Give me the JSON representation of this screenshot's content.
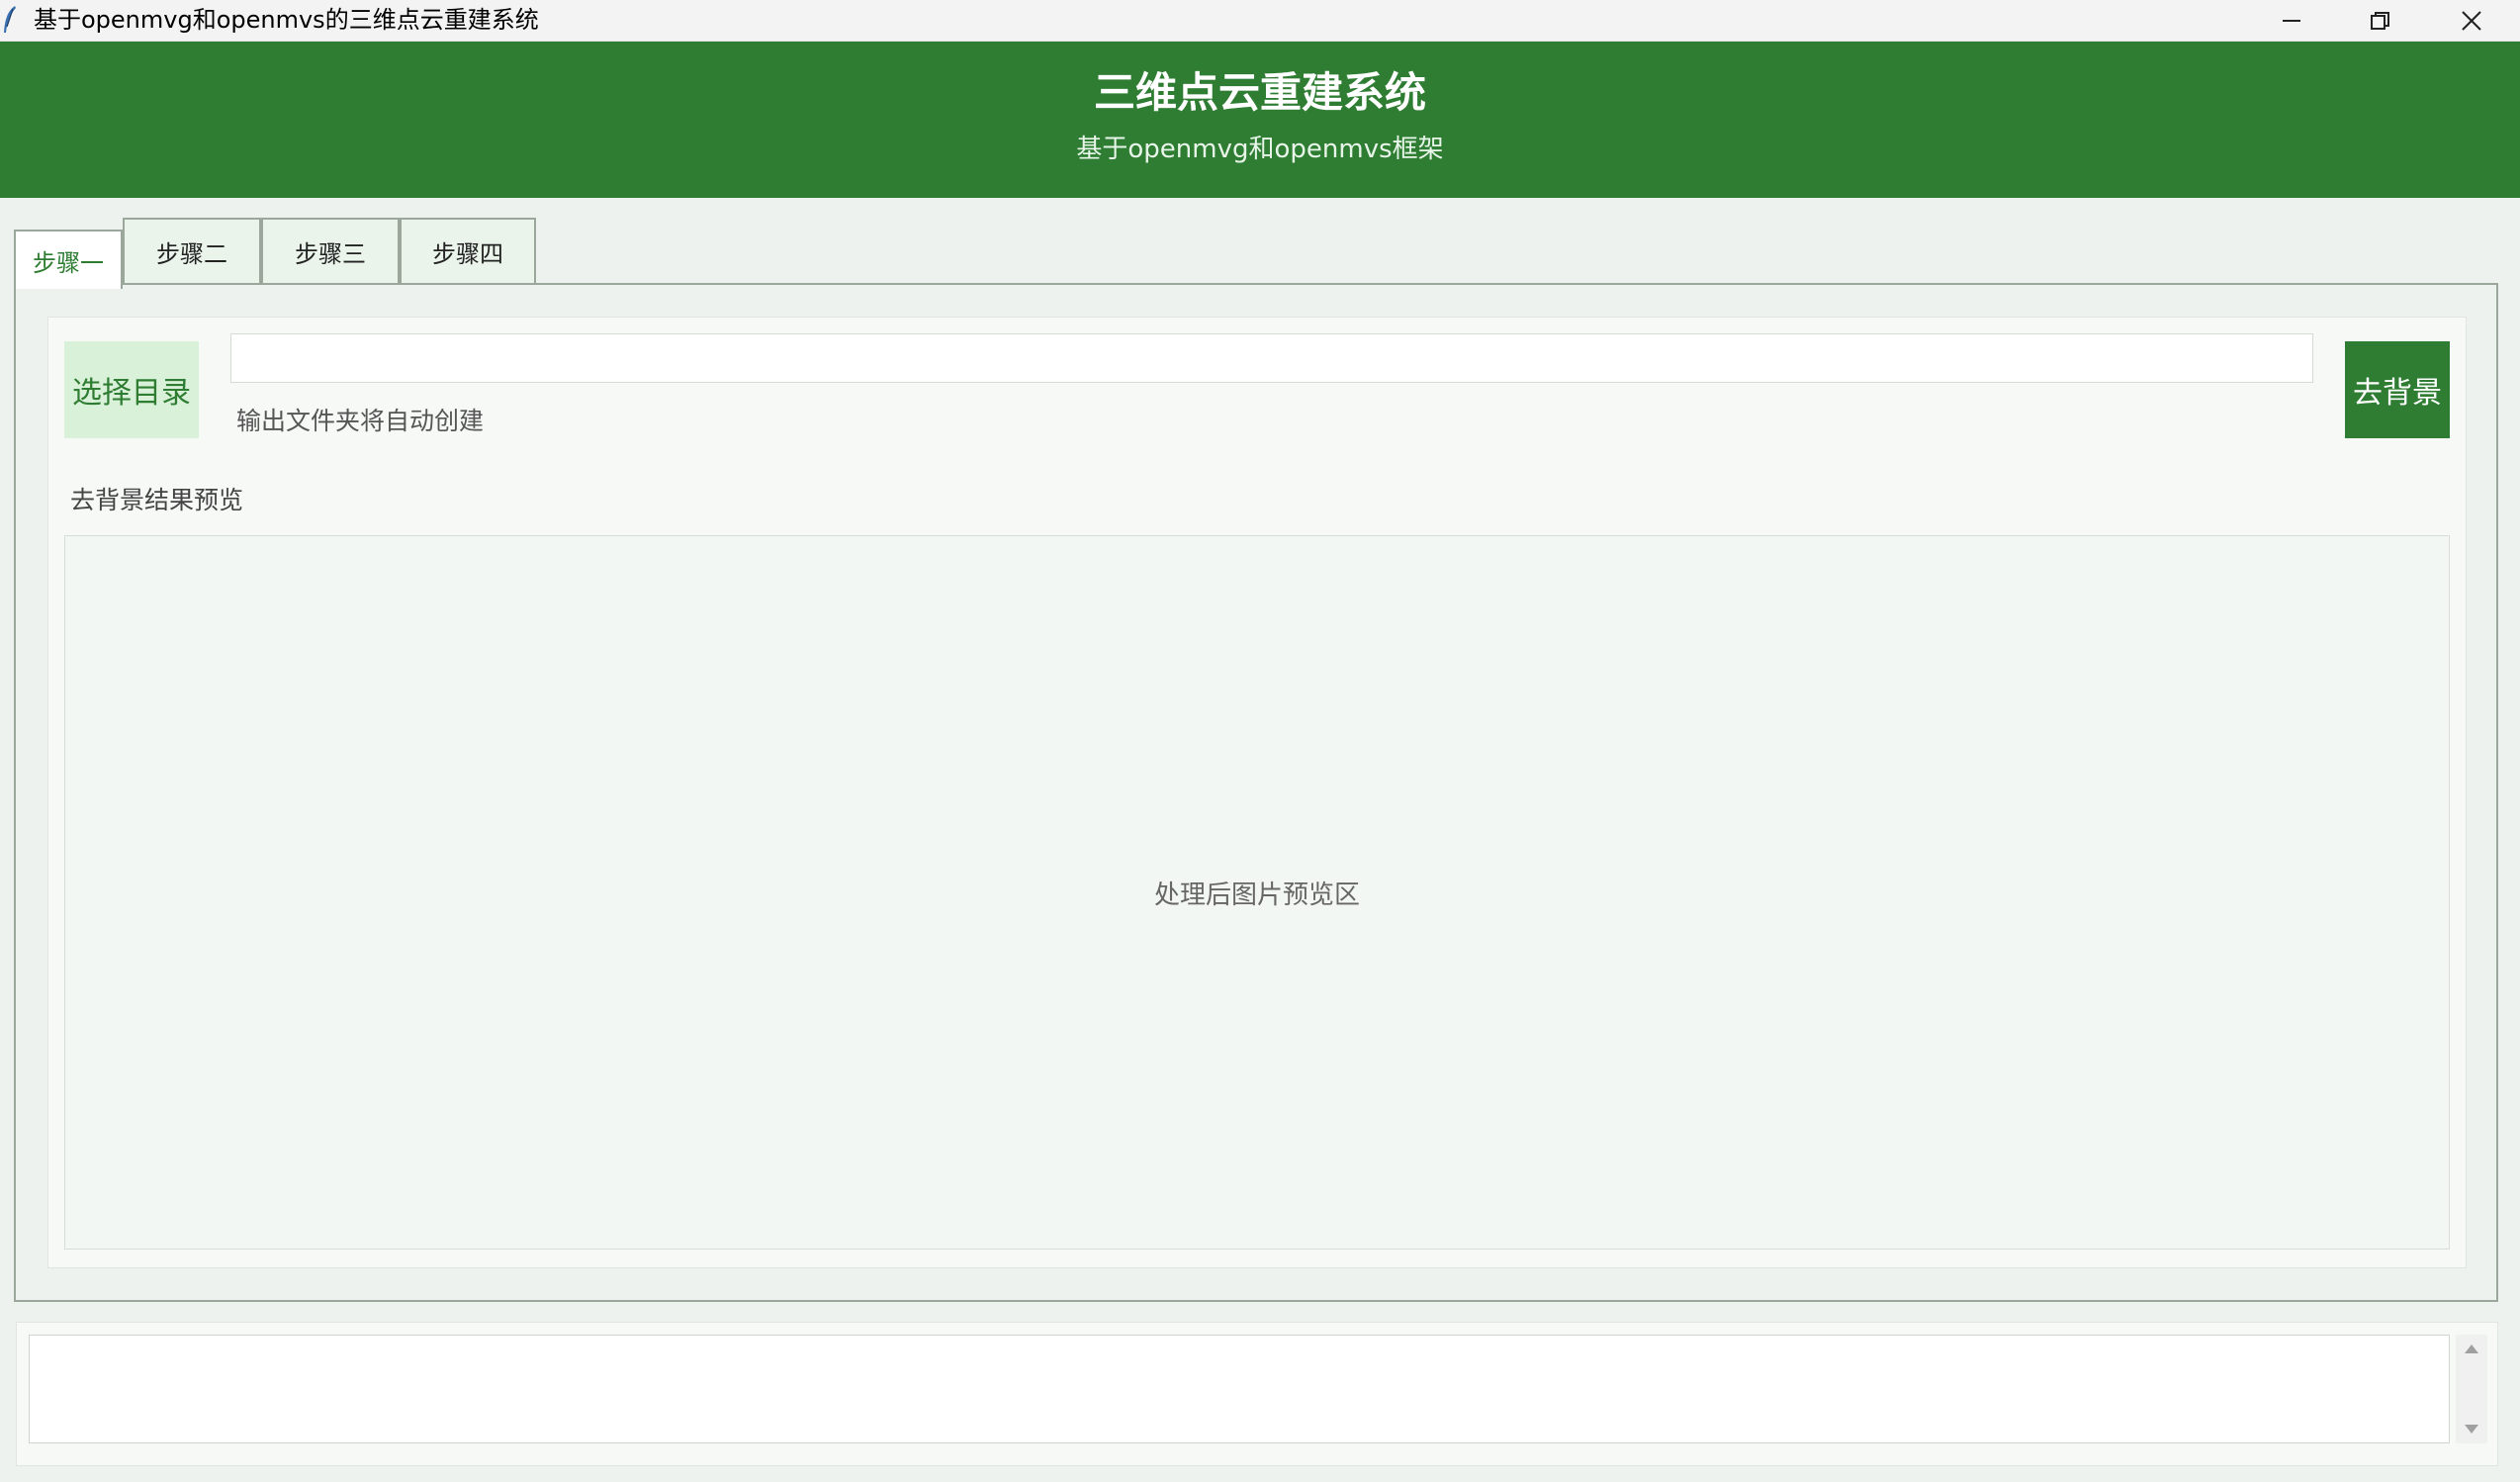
{
  "window": {
    "title": "基于openmvg和openmvs的三维点云重建系统"
  },
  "header": {
    "title": "三维点云重建系统",
    "subtitle": "基于openmvg和openmvs框架"
  },
  "tabs": [
    {
      "label": "步骤一",
      "active": true
    },
    {
      "label": "步骤二",
      "active": false
    },
    {
      "label": "步骤三",
      "active": false
    },
    {
      "label": "步骤四",
      "active": false
    }
  ],
  "step1": {
    "choose_dir_label": "选择目录",
    "path_value": "",
    "hint": "输出文件夹将自动创建",
    "remove_bg_label": "去背景",
    "preview_label": "去背景结果预览",
    "preview_placeholder": "处理后图片预览区"
  },
  "log": {
    "content": ""
  },
  "colors": {
    "primary": "#2e7d32",
    "light_green": "#d9f0d9",
    "background": "#eef2ee"
  },
  "icons": [
    "app-feather-icon",
    "minimize-icon",
    "restore-icon",
    "close-icon",
    "scroll-up-arrow-icon",
    "scroll-down-arrow-icon"
  ]
}
